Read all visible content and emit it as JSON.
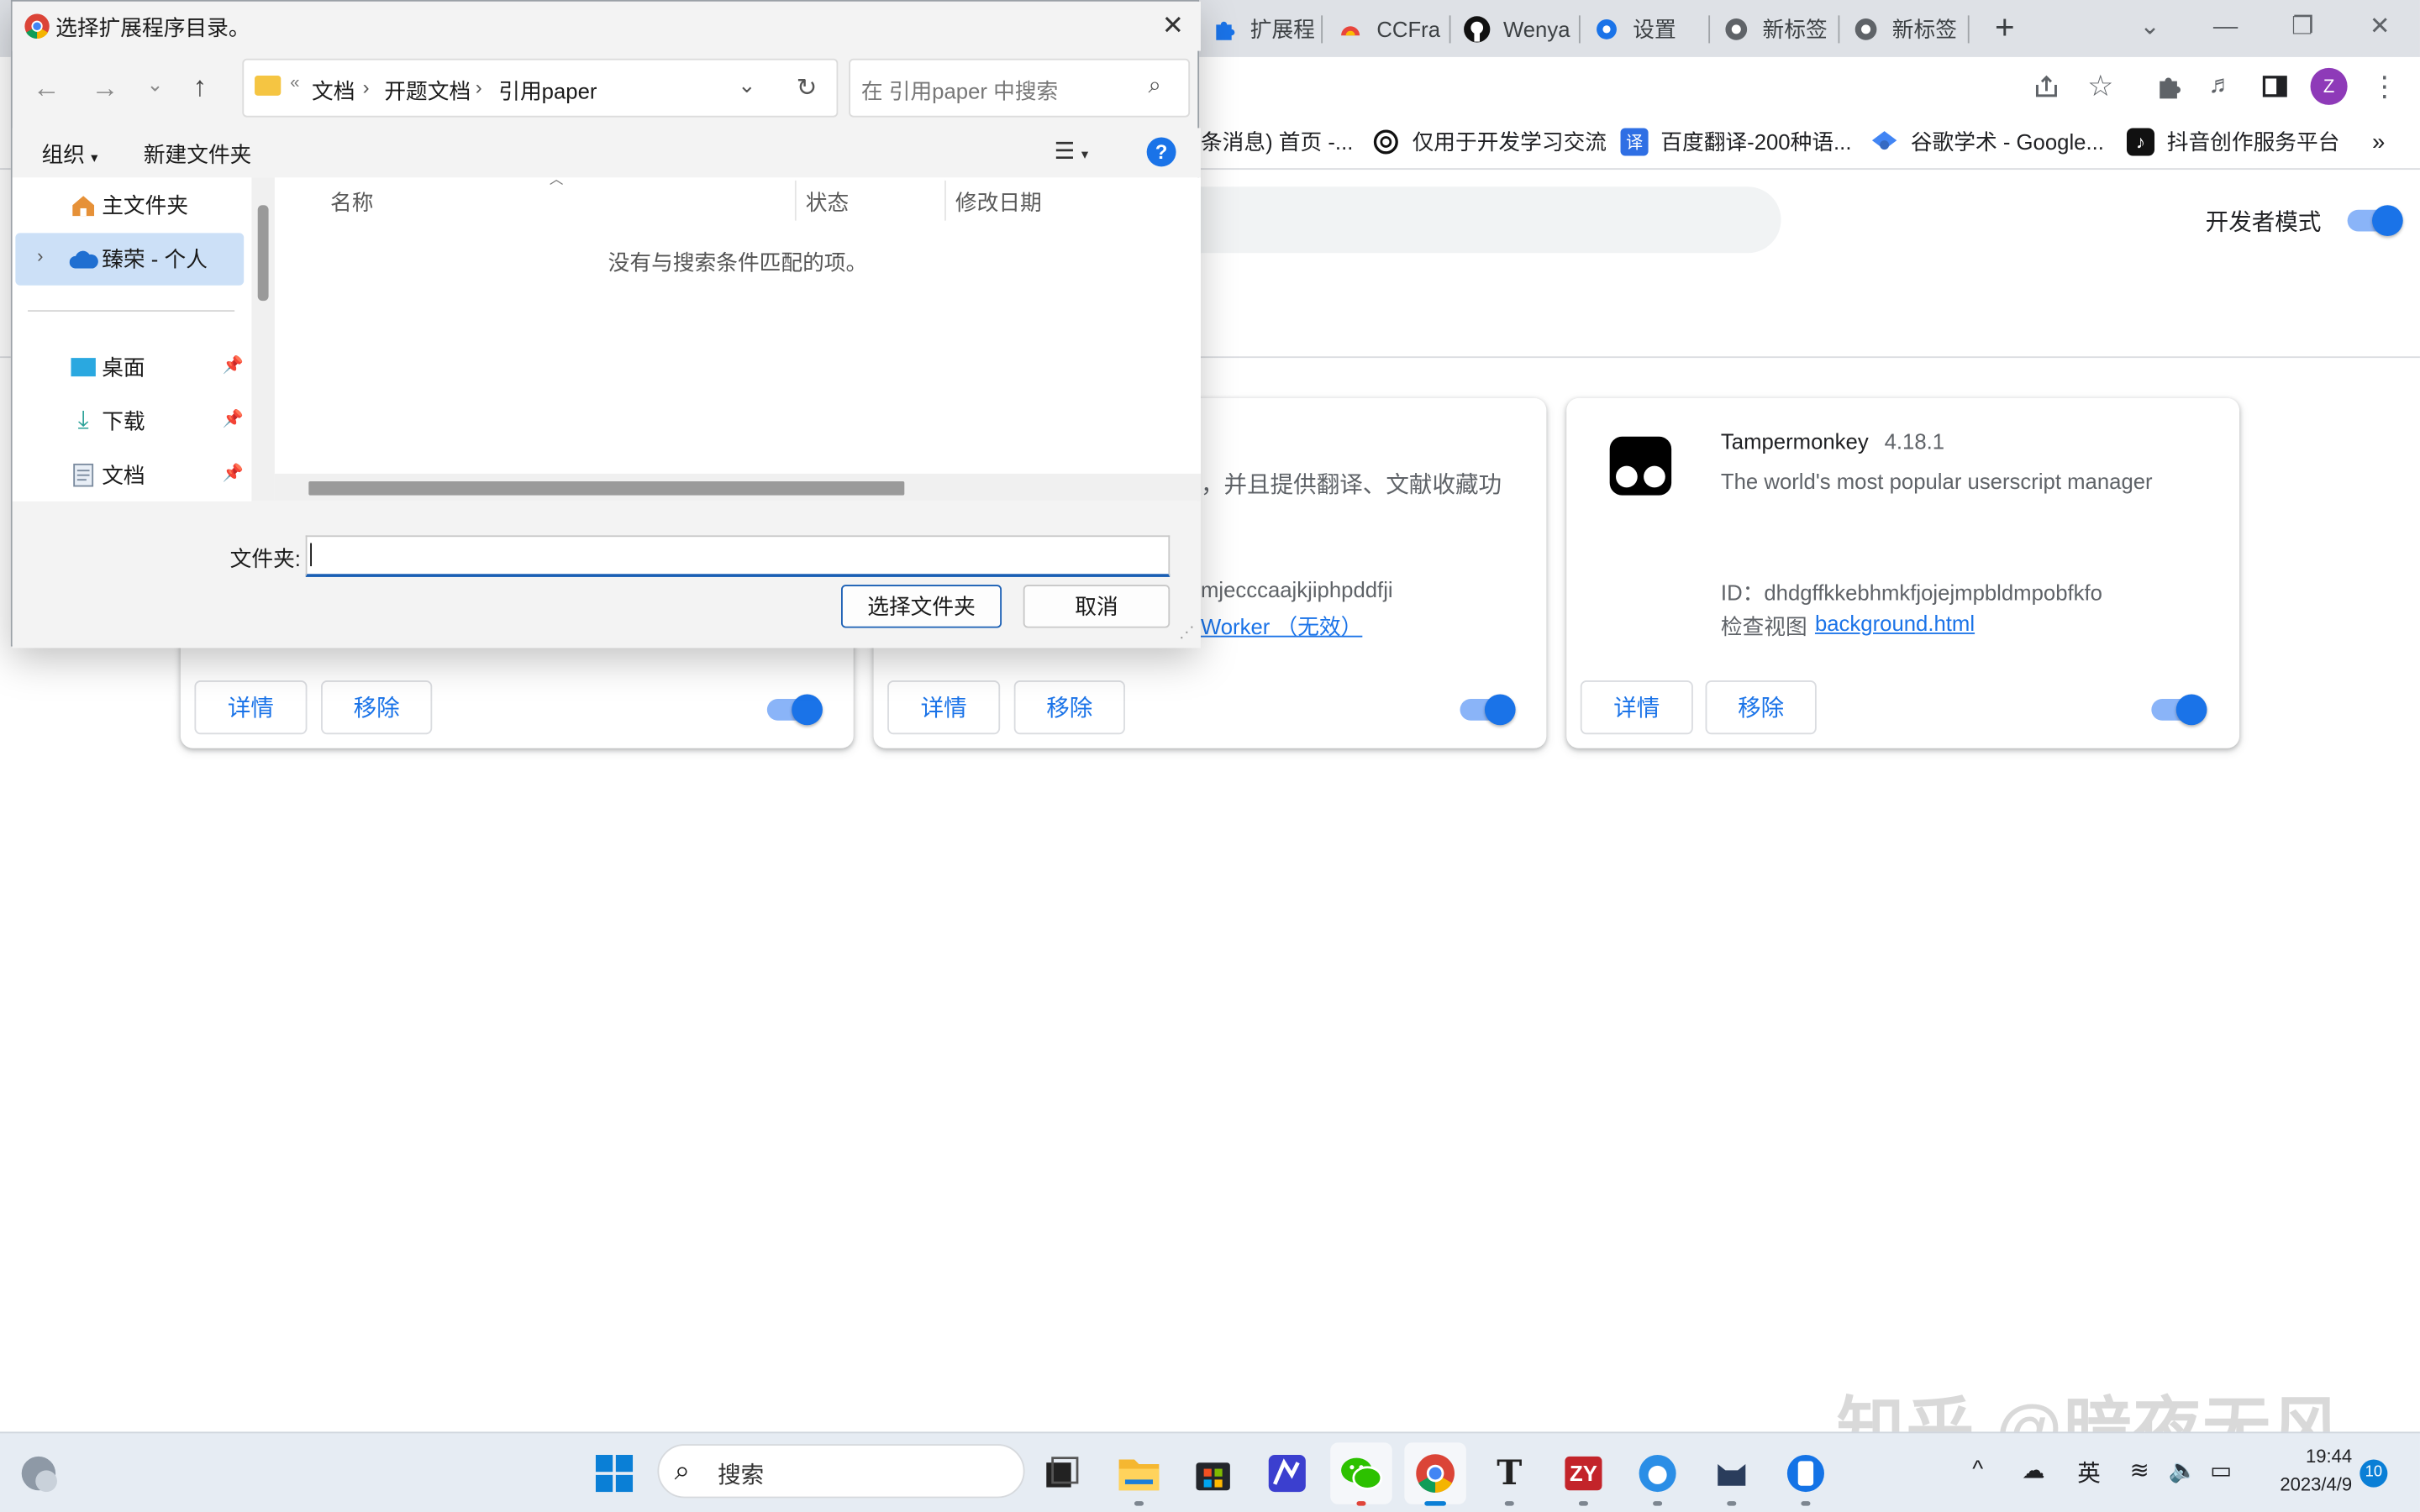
{
  "browser": {
    "tabs": [
      {
        "label": "扩展程",
        "icon": "puzzle-icon"
      },
      {
        "label": "CCFra",
        "icon": "ccf-icon"
      },
      {
        "label": "Wenya",
        "icon": "github-icon"
      },
      {
        "label": "设置",
        "icon": "gear-icon"
      },
      {
        "label": "新标签",
        "icon": "chrome-icon"
      },
      {
        "label": "新标签",
        "icon": "chrome-icon"
      }
    ],
    "new_tab_label": "+",
    "profile_initial": "Z",
    "bookmarks": [
      {
        "label": "条消息) 首页 -...",
        "icon": ""
      },
      {
        "label": "仅用于开发学习交流",
        "icon": "openai-icon"
      },
      {
        "label": "百度翻译-200种语...",
        "icon": "translate-icon"
      },
      {
        "label": "谷歌学术 - Google...",
        "icon": "scholar-icon"
      },
      {
        "label": "抖音创作服务平台",
        "icon": "douyin-icon"
      }
    ],
    "bookmarks_more": "»"
  },
  "extensions_page": {
    "dev_mode_label": "开发者模式",
    "dev_mode_on": true,
    "cards": [
      {
        "details_label": "详情",
        "remove_label": "移除",
        "enabled": true
      },
      {
        "description": "，并且提供翻译、文献收藏功",
        "id_line": "mjecccaajkjiphpddfji",
        "inspect_link": "Worker （无效）",
        "details_label": "详情",
        "remove_label": "移除",
        "enabled": true
      },
      {
        "name": "Tampermonkey",
        "version": "4.18.1",
        "description": "The world's most popular userscript manager",
        "id_line": "ID：dhdgffkkebhmkfjojejmpbldmpobfkfo",
        "inspect_label": "检查视图",
        "inspect_link": "background.html",
        "details_label": "详情",
        "remove_label": "移除",
        "enabled": true
      }
    ]
  },
  "dialog": {
    "title": "选择扩展程序目录。",
    "breadcrumb": [
      "文档",
      "开题文档",
      "引用paper"
    ],
    "breadcrumb_prefix": "«",
    "search_placeholder": "在 引用paper 中搜索",
    "organize_label": "组织",
    "new_folder_label": "新建文件夹",
    "nav_items": [
      {
        "label": "主文件夹",
        "icon": "home-icon"
      },
      {
        "label": "臻荣 - 个人",
        "icon": "onedrive-icon",
        "selected": true
      },
      {
        "label": "桌面",
        "icon": "desktop-icon",
        "pinned": true
      },
      {
        "label": "下载",
        "icon": "download-icon",
        "pinned": true
      },
      {
        "label": "文档",
        "icon": "documents-icon",
        "pinned": true
      }
    ],
    "columns": [
      "名称",
      "状态",
      "修改日期"
    ],
    "empty_message": "没有与搜索条件匹配的项。",
    "folder_label": "文件夹:",
    "folder_value": "",
    "select_button": "选择文件夹",
    "cancel_button": "取消"
  },
  "taskbar": {
    "search_label": "搜索",
    "tray_lang": "英",
    "time": "19:44",
    "date": "2023/4/9",
    "notification_count": "10"
  },
  "watermark": "知乎 @暗夜无风"
}
